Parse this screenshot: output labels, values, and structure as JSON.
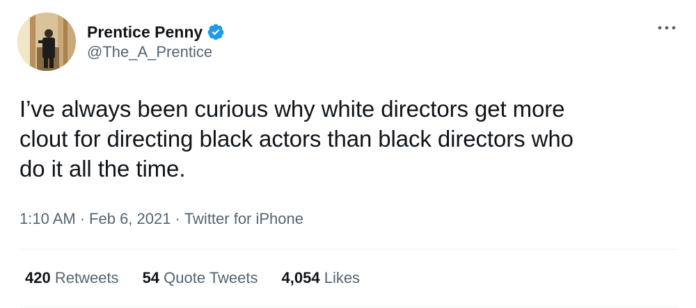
{
  "author": {
    "display_name": "Prentice Penny",
    "handle": "@The_A_Prentice",
    "verified": true,
    "verified_color": "#1d9bf0"
  },
  "more_icon": "more-options-icon",
  "tweet": {
    "text": "I’ve always been curious why white directors get more\nclout for directing black actors than black directors who\ndo it all the time."
  },
  "meta": {
    "time": "1:10 AM",
    "separator": "·",
    "date": "Feb 6, 2021",
    "source": "Twitter for iPhone"
  },
  "stats": [
    {
      "count": "420",
      "label": "Retweets"
    },
    {
      "count": "54",
      "label": "Quote Tweets"
    },
    {
      "count": "4,054",
      "label": "Likes"
    }
  ]
}
